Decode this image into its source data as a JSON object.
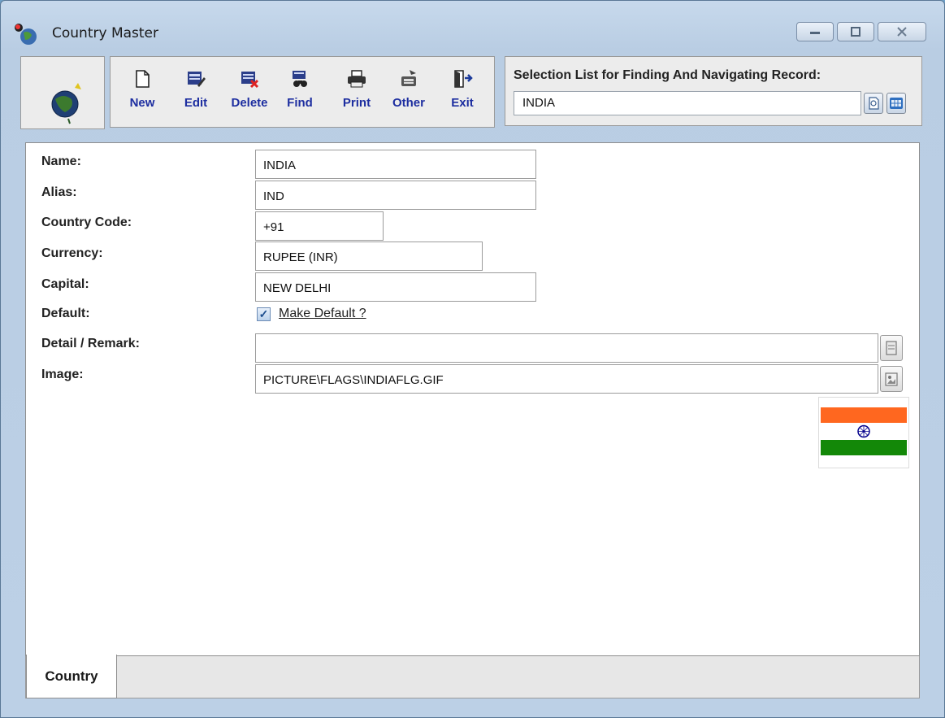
{
  "window": {
    "title": "Country Master",
    "controls": {
      "minimize": "‒",
      "maximize": "◻",
      "close": "✕"
    }
  },
  "toolbar": {
    "buttons": [
      {
        "label": "New",
        "icon": "new-document-icon"
      },
      {
        "label": "Edit",
        "icon": "edit-icon"
      },
      {
        "label": "Delete",
        "icon": "delete-icon"
      },
      {
        "label": "Find",
        "icon": "find-binoculars-icon"
      },
      {
        "label": "Print",
        "icon": "printer-icon"
      },
      {
        "label": "Other",
        "icon": "other-icon"
      },
      {
        "label": "Exit",
        "icon": "exit-door-icon"
      }
    ],
    "label_color": "#1d2ea0"
  },
  "selection": {
    "label": "Selection List for Finding And Navigating Record:",
    "value": "INDIA"
  },
  "form": {
    "name_label": "Name:",
    "name_value": "INDIA",
    "alias_label": "Alias:",
    "alias_value": "IND",
    "code_label": "Country Code:",
    "code_value": "+91",
    "currency_label": "Currency:",
    "currency_value": "RUPEE (INR)",
    "capital_label": "Capital:",
    "capital_value": "NEW DELHI",
    "default_label": "Default:",
    "default_checkbox_label": "Make Default ?",
    "default_checked": true,
    "remark_label": "Detail / Remark:",
    "remark_value": "",
    "image_label": "Image:",
    "image_value": "PICTURE\\FLAGS\\INDIAFLG.GIF"
  },
  "flag": {
    "saffron": "#ff671f",
    "white": "#ffffff",
    "green": "#138808",
    "chakra": "#06038d"
  },
  "tabs": [
    {
      "label": "Country",
      "active": true
    }
  ]
}
